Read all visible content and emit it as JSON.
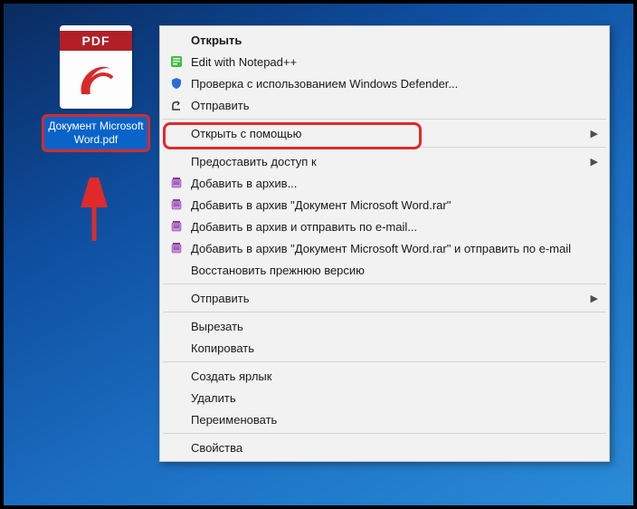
{
  "file": {
    "badge": "PDF",
    "label": "Документ Microsoft\nWord.pdf"
  },
  "menu": {
    "open": "Открыть",
    "edit_notepad": "Edit with Notepad++",
    "defender": "Проверка с использованием Windows Defender...",
    "share_win": "Отправить",
    "open_with": "Открыть с помощью",
    "grant_access": "Предоставить доступ к",
    "rar_add": "Добавить в архив...",
    "rar_add_named": "Добавить в архив \"Документ Microsoft Word.rar\"",
    "rar_add_email": "Добавить в архив и отправить по e-mail...",
    "rar_add_named_email": "Добавить в архив \"Документ Microsoft Word.rar\" и отправить по e-mail",
    "restore": "Восстановить прежнюю версию",
    "send_to": "Отправить",
    "cut": "Вырезать",
    "copy": "Копировать",
    "shortcut": "Создать ярлык",
    "delete": "Удалить",
    "rename": "Переименовать",
    "properties": "Свойства",
    "submenu_glyph": "▶"
  }
}
